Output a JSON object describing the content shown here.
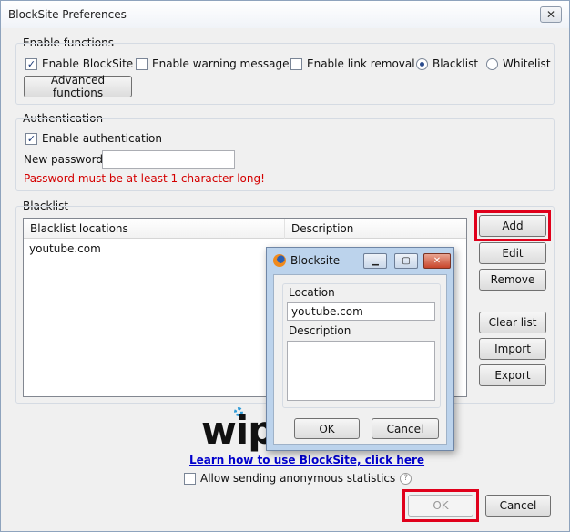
{
  "window": {
    "title": "BlockSite Preferences",
    "close_glyph": "✕"
  },
  "enable_functions": {
    "group_label": "Enable functions",
    "enable_blocksite": {
      "label": "Enable BlockSite",
      "checked": true
    },
    "enable_warning": {
      "label": "Enable warning messages",
      "checked": false
    },
    "enable_link_removal": {
      "label": "Enable link removal",
      "checked": false
    },
    "blacklist_radio": {
      "label": "Blacklist",
      "selected": true
    },
    "whitelist_radio": {
      "label": "Whitelist",
      "selected": false
    },
    "advanced_button": "Advanced functions"
  },
  "authentication": {
    "group_label": "Authentication",
    "enable_auth": {
      "label": "Enable authentication",
      "checked": true
    },
    "password_label": "New password",
    "password_value": "",
    "error": "Password must be at least 1 character long!"
  },
  "blacklist": {
    "group_label": "Blacklist",
    "columns": [
      "Blacklist locations",
      "Description"
    ],
    "rows": [
      {
        "location": "youtube.com",
        "description": ""
      }
    ],
    "buttons": {
      "add": "Add",
      "edit": "Edit",
      "remove": "Remove",
      "clear": "Clear list",
      "import": "Import",
      "export": "Export"
    }
  },
  "dialog": {
    "title": "Blocksite",
    "location_label": "Location",
    "location_value": "youtube.com",
    "description_label": "Description",
    "description_value": "",
    "ok": "OK",
    "cancel": "Cancel",
    "min_glyph": "▁",
    "max_glyph": "▢",
    "close_glyph": "✕"
  },
  "footer": {
    "logo_text": "wip",
    "learn_link": "Learn how to use BlockSite, click here",
    "anon_stats": {
      "label": "Allow sending anonymous statistics",
      "checked": false
    },
    "help_glyph": "?",
    "ok": "OK",
    "cancel": "Cancel"
  },
  "colors": {
    "highlight": "#e0001b",
    "error": "#d40000",
    "link": "#0000cc"
  }
}
